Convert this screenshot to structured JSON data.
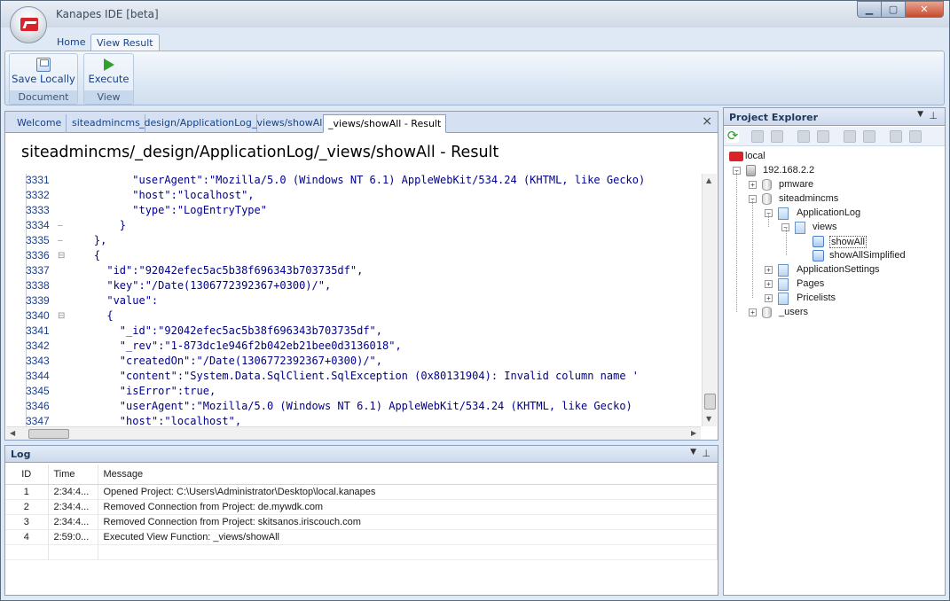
{
  "window": {
    "title": "Kanapes IDE [beta]"
  },
  "ribbon": {
    "tabs": [
      {
        "label": "Home"
      },
      {
        "label": "View Result"
      }
    ],
    "groups": [
      {
        "label": "Document",
        "button": "Save Locally"
      },
      {
        "label": "View",
        "button": "Execute"
      }
    ]
  },
  "document": {
    "tabs": [
      {
        "label": "Welcome"
      },
      {
        "label": "siteadmincms"
      },
      {
        "label": "_design/ApplicationLog"
      },
      {
        "label": "_views/showAll"
      },
      {
        "label": "_views/showAll - Result"
      }
    ],
    "close": "×",
    "title": "siteadmincms/_design/ApplicationLog/_views/showAll - Result",
    "code": [
      {
        "ln": "3331",
        "fold": "",
        "text": "          \"userAgent\":\"Mozilla/5.0 (Windows NT 6.1) AppleWebKit/534.24 (KHTML, like Gecko)"
      },
      {
        "ln": "3332",
        "fold": "",
        "text": "          \"host\":\"localhost\","
      },
      {
        "ln": "3333",
        "fold": "",
        "text": "          \"type\":\"LogEntryType\""
      },
      {
        "ln": "3334",
        "fold": "–",
        "text": "        }"
      },
      {
        "ln": "3335",
        "fold": "–",
        "text": "    },"
      },
      {
        "ln": "3336",
        "fold": "⊟",
        "text": "    {"
      },
      {
        "ln": "3337",
        "fold": "",
        "text": "      \"id\":\"92042efec5ac5b38f696343b703735df\","
      },
      {
        "ln": "3338",
        "fold": "",
        "text": "      \"key\":\"/Date(1306772392367+0300)/\","
      },
      {
        "ln": "3339",
        "fold": "",
        "text": "      \"value\":"
      },
      {
        "ln": "3340",
        "fold": "⊟",
        "text": "      {"
      },
      {
        "ln": "3341",
        "fold": "",
        "text": "        \"_id\":\"92042efec5ac5b38f696343b703735df\","
      },
      {
        "ln": "3342",
        "fold": "",
        "text": "        \"_rev\":\"1-873dc1e946f2b042eb21bee0d3136018\","
      },
      {
        "ln": "3343",
        "fold": "",
        "text": "        \"createdOn\":\"/Date(1306772392367+0300)/\","
      },
      {
        "ln": "3344",
        "fold": "",
        "text": "        \"content\":\"System.Data.SqlClient.SqlException (0x80131904): Invalid column name '"
      },
      {
        "ln": "3345",
        "fold": "",
        "text": "        \"isError\":true,"
      },
      {
        "ln": "3346",
        "fold": "",
        "text": "        \"userAgent\":\"Mozilla/5.0 (Windows NT 6.1) AppleWebKit/534.24 (KHTML, like Gecko)"
      },
      {
        "ln": "3347",
        "fold": "",
        "text": "        \"host\":\"localhost\","
      }
    ]
  },
  "log": {
    "title": "Log",
    "columns": [
      "ID",
      "Time",
      "Message"
    ],
    "rows": [
      {
        "id": "1",
        "time": "2:34:4...",
        "message": "Opened Project: C:\\Users\\Administrator\\Desktop\\local.kanapes"
      },
      {
        "id": "2",
        "time": "2:34:4...",
        "message": "Removed Connection from Project: de.mywdk.com"
      },
      {
        "id": "3",
        "time": "2:34:4...",
        "message": "Removed Connection from Project: skitsanos.iriscouch.com"
      },
      {
        "id": "4",
        "time": "2:59:0...",
        "message": "Executed View Function: _views/showAll"
      }
    ]
  },
  "explorer": {
    "title": "Project Explorer",
    "tree": [
      {
        "label": "local",
        "icon": "kanapes-logo-icon",
        "expander": ""
      },
      {
        "label": "192.168.2.2",
        "icon": "server-icon",
        "expander": "−"
      },
      {
        "label": "pmware",
        "icon": "database-icon",
        "expander": "+"
      },
      {
        "label": "siteadmincms",
        "icon": "database-icon",
        "expander": "−"
      },
      {
        "label": "ApplicationLog",
        "icon": "document-icon",
        "expander": "−"
      },
      {
        "label": "views",
        "icon": "document-icon",
        "expander": "−"
      },
      {
        "label": "showAll",
        "icon": "view-icon",
        "expander": ""
      },
      {
        "label": "showAllSimplified",
        "icon": "view-icon",
        "expander": ""
      },
      {
        "label": "ApplicationSettings",
        "icon": "document-icon",
        "expander": "+"
      },
      {
        "label": "Pages",
        "icon": "document-icon",
        "expander": "+"
      },
      {
        "label": "Pricelists",
        "icon": "document-icon",
        "expander": "+"
      },
      {
        "label": "_users",
        "icon": "database-icon",
        "expander": "+"
      }
    ]
  }
}
